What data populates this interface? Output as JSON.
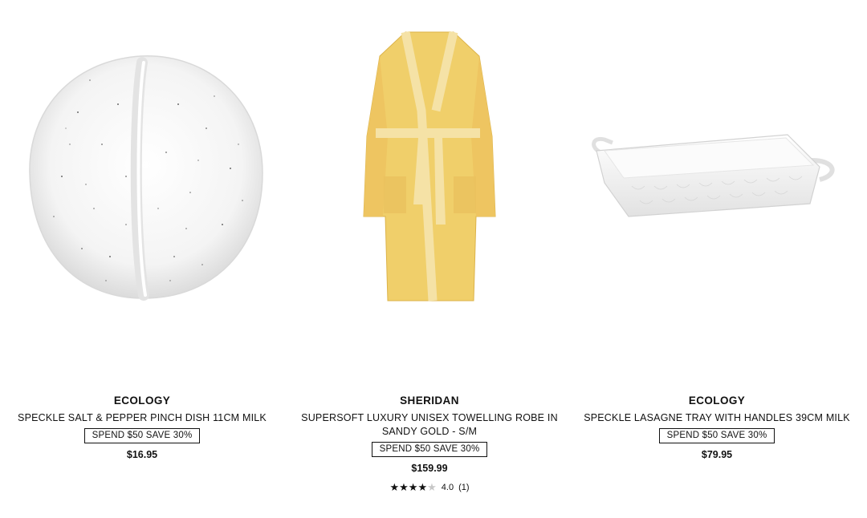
{
  "products": [
    {
      "brand": "ECOLOGY",
      "title": "SPECKLE SALT & PEPPER PINCH DISH 11CM MILK",
      "promo": "SPEND $50 SAVE 30%",
      "price": "$16.95",
      "image": "speckle-pinch-dish"
    },
    {
      "brand": "SHERIDAN",
      "title": "SUPERSOFT LUXURY UNISEX TOWELLING ROBE IN SANDY GOLD - S/M",
      "promo": "SPEND $50 SAVE 30%",
      "price": "$159.99",
      "image": "towelling-robe",
      "rating": {
        "stars_filled": 4,
        "stars_total": 5,
        "value": "4.0",
        "count": "(1)"
      }
    },
    {
      "brand": "ECOLOGY",
      "title": "SPECKLE LASAGNE TRAY WITH HANDLES 39CM MILK",
      "promo": "SPEND $50 SAVE 30%",
      "price": "$79.95",
      "image": "lasagne-tray"
    }
  ],
  "colors": {
    "text": "#111111",
    "robe": "#f0cf6a",
    "robe_trim": "#f5e2a6",
    "ceramic": "#f7f7f7"
  }
}
